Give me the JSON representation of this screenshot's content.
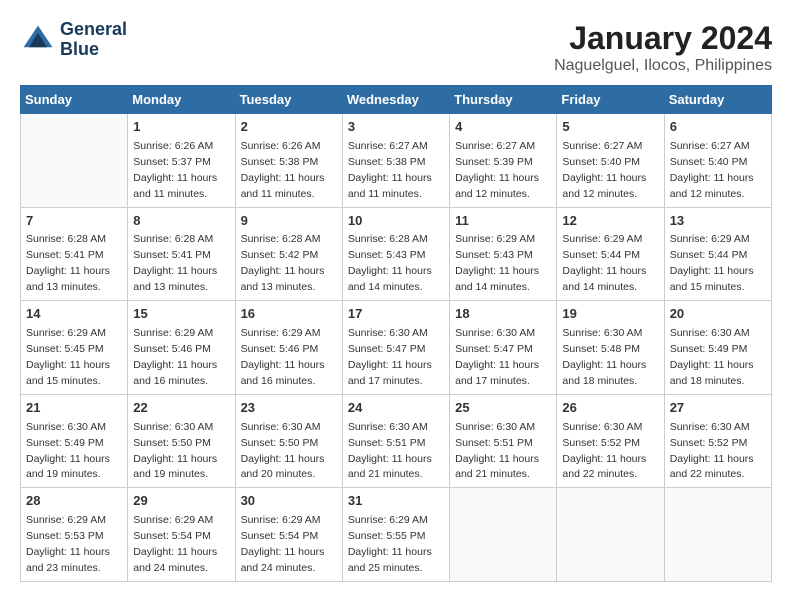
{
  "logo": {
    "line1": "General",
    "line2": "Blue"
  },
  "title": "January 2024",
  "subtitle": "Naguelguel, Ilocos, Philippines",
  "headers": [
    "Sunday",
    "Monday",
    "Tuesday",
    "Wednesday",
    "Thursday",
    "Friday",
    "Saturday"
  ],
  "weeks": [
    [
      {
        "day": "",
        "sunrise": "",
        "sunset": "",
        "daylight": ""
      },
      {
        "day": "1",
        "sunrise": "Sunrise: 6:26 AM",
        "sunset": "Sunset: 5:37 PM",
        "daylight": "Daylight: 11 hours and 11 minutes."
      },
      {
        "day": "2",
        "sunrise": "Sunrise: 6:26 AM",
        "sunset": "Sunset: 5:38 PM",
        "daylight": "Daylight: 11 hours and 11 minutes."
      },
      {
        "day": "3",
        "sunrise": "Sunrise: 6:27 AM",
        "sunset": "Sunset: 5:38 PM",
        "daylight": "Daylight: 11 hours and 11 minutes."
      },
      {
        "day": "4",
        "sunrise": "Sunrise: 6:27 AM",
        "sunset": "Sunset: 5:39 PM",
        "daylight": "Daylight: 11 hours and 12 minutes."
      },
      {
        "day": "5",
        "sunrise": "Sunrise: 6:27 AM",
        "sunset": "Sunset: 5:40 PM",
        "daylight": "Daylight: 11 hours and 12 minutes."
      },
      {
        "day": "6",
        "sunrise": "Sunrise: 6:27 AM",
        "sunset": "Sunset: 5:40 PM",
        "daylight": "Daylight: 11 hours and 12 minutes."
      }
    ],
    [
      {
        "day": "7",
        "sunrise": "Sunrise: 6:28 AM",
        "sunset": "Sunset: 5:41 PM",
        "daylight": "Daylight: 11 hours and 13 minutes."
      },
      {
        "day": "8",
        "sunrise": "Sunrise: 6:28 AM",
        "sunset": "Sunset: 5:41 PM",
        "daylight": "Daylight: 11 hours and 13 minutes."
      },
      {
        "day": "9",
        "sunrise": "Sunrise: 6:28 AM",
        "sunset": "Sunset: 5:42 PM",
        "daylight": "Daylight: 11 hours and 13 minutes."
      },
      {
        "day": "10",
        "sunrise": "Sunrise: 6:28 AM",
        "sunset": "Sunset: 5:43 PM",
        "daylight": "Daylight: 11 hours and 14 minutes."
      },
      {
        "day": "11",
        "sunrise": "Sunrise: 6:29 AM",
        "sunset": "Sunset: 5:43 PM",
        "daylight": "Daylight: 11 hours and 14 minutes."
      },
      {
        "day": "12",
        "sunrise": "Sunrise: 6:29 AM",
        "sunset": "Sunset: 5:44 PM",
        "daylight": "Daylight: 11 hours and 14 minutes."
      },
      {
        "day": "13",
        "sunrise": "Sunrise: 6:29 AM",
        "sunset": "Sunset: 5:44 PM",
        "daylight": "Daylight: 11 hours and 15 minutes."
      }
    ],
    [
      {
        "day": "14",
        "sunrise": "Sunrise: 6:29 AM",
        "sunset": "Sunset: 5:45 PM",
        "daylight": "Daylight: 11 hours and 15 minutes."
      },
      {
        "day": "15",
        "sunrise": "Sunrise: 6:29 AM",
        "sunset": "Sunset: 5:46 PM",
        "daylight": "Daylight: 11 hours and 16 minutes."
      },
      {
        "day": "16",
        "sunrise": "Sunrise: 6:29 AM",
        "sunset": "Sunset: 5:46 PM",
        "daylight": "Daylight: 11 hours and 16 minutes."
      },
      {
        "day": "17",
        "sunrise": "Sunrise: 6:30 AM",
        "sunset": "Sunset: 5:47 PM",
        "daylight": "Daylight: 11 hours and 17 minutes."
      },
      {
        "day": "18",
        "sunrise": "Sunrise: 6:30 AM",
        "sunset": "Sunset: 5:47 PM",
        "daylight": "Daylight: 11 hours and 17 minutes."
      },
      {
        "day": "19",
        "sunrise": "Sunrise: 6:30 AM",
        "sunset": "Sunset: 5:48 PM",
        "daylight": "Daylight: 11 hours and 18 minutes."
      },
      {
        "day": "20",
        "sunrise": "Sunrise: 6:30 AM",
        "sunset": "Sunset: 5:49 PM",
        "daylight": "Daylight: 11 hours and 18 minutes."
      }
    ],
    [
      {
        "day": "21",
        "sunrise": "Sunrise: 6:30 AM",
        "sunset": "Sunset: 5:49 PM",
        "daylight": "Daylight: 11 hours and 19 minutes."
      },
      {
        "day": "22",
        "sunrise": "Sunrise: 6:30 AM",
        "sunset": "Sunset: 5:50 PM",
        "daylight": "Daylight: 11 hours and 19 minutes."
      },
      {
        "day": "23",
        "sunrise": "Sunrise: 6:30 AM",
        "sunset": "Sunset: 5:50 PM",
        "daylight": "Daylight: 11 hours and 20 minutes."
      },
      {
        "day": "24",
        "sunrise": "Sunrise: 6:30 AM",
        "sunset": "Sunset: 5:51 PM",
        "daylight": "Daylight: 11 hours and 21 minutes."
      },
      {
        "day": "25",
        "sunrise": "Sunrise: 6:30 AM",
        "sunset": "Sunset: 5:51 PM",
        "daylight": "Daylight: 11 hours and 21 minutes."
      },
      {
        "day": "26",
        "sunrise": "Sunrise: 6:30 AM",
        "sunset": "Sunset: 5:52 PM",
        "daylight": "Daylight: 11 hours and 22 minutes."
      },
      {
        "day": "27",
        "sunrise": "Sunrise: 6:30 AM",
        "sunset": "Sunset: 5:52 PM",
        "daylight": "Daylight: 11 hours and 22 minutes."
      }
    ],
    [
      {
        "day": "28",
        "sunrise": "Sunrise: 6:29 AM",
        "sunset": "Sunset: 5:53 PM",
        "daylight": "Daylight: 11 hours and 23 minutes."
      },
      {
        "day": "29",
        "sunrise": "Sunrise: 6:29 AM",
        "sunset": "Sunset: 5:54 PM",
        "daylight": "Daylight: 11 hours and 24 minutes."
      },
      {
        "day": "30",
        "sunrise": "Sunrise: 6:29 AM",
        "sunset": "Sunset: 5:54 PM",
        "daylight": "Daylight: 11 hours and 24 minutes."
      },
      {
        "day": "31",
        "sunrise": "Sunrise: 6:29 AM",
        "sunset": "Sunset: 5:55 PM",
        "daylight": "Daylight: 11 hours and 25 minutes."
      },
      {
        "day": "",
        "sunrise": "",
        "sunset": "",
        "daylight": ""
      },
      {
        "day": "",
        "sunrise": "",
        "sunset": "",
        "daylight": ""
      },
      {
        "day": "",
        "sunrise": "",
        "sunset": "",
        "daylight": ""
      }
    ]
  ]
}
